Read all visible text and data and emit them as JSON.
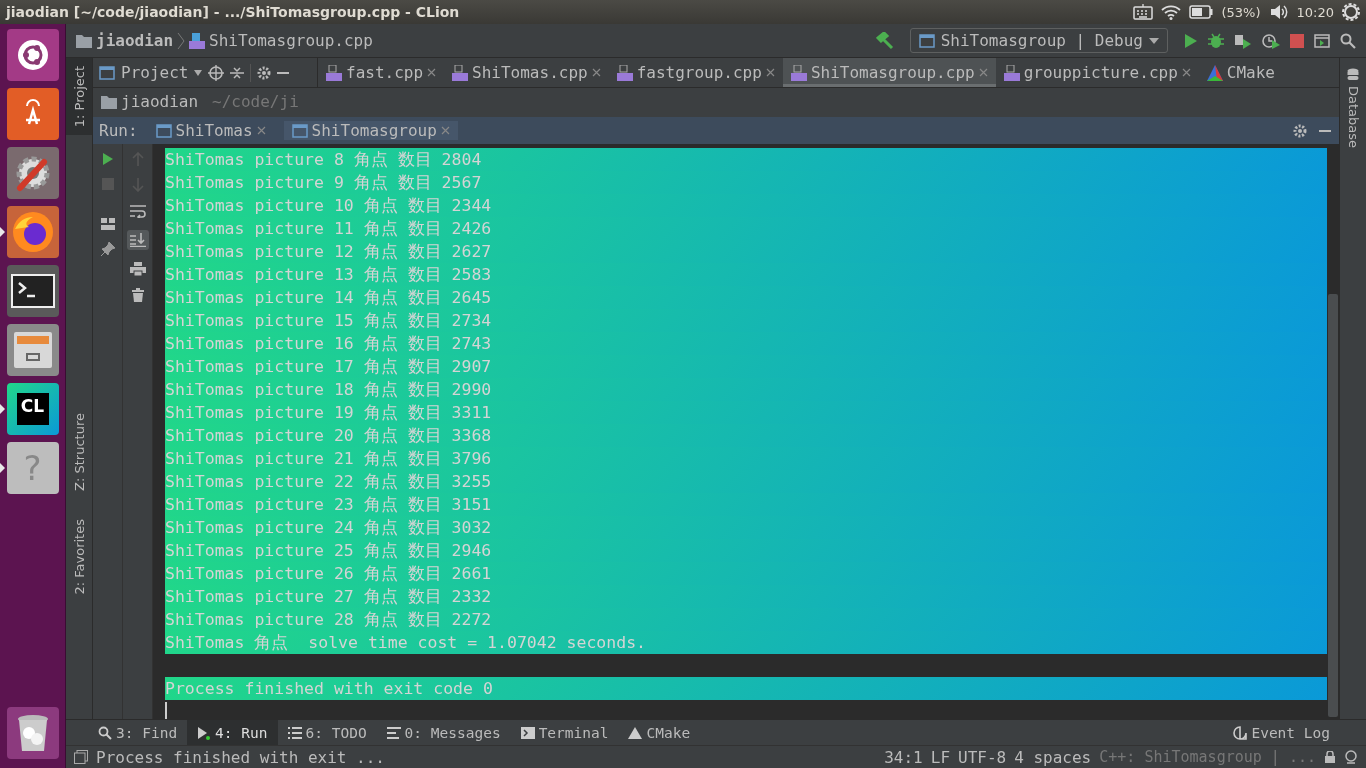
{
  "top_bar": {
    "title": "jiaodian [~/code/jiaodian] - .../ShiTomasgroup.cpp - CLion",
    "battery": "(53%)",
    "clock": "10:20"
  },
  "launcher": [
    {
      "kind": "ubuntu",
      "running": false
    },
    {
      "kind": "software",
      "running": false
    },
    {
      "kind": "settings",
      "running": false
    },
    {
      "kind": "browser",
      "running": true
    },
    {
      "kind": "terminal",
      "running": false
    },
    {
      "kind": "files",
      "running": false
    },
    {
      "kind": "clion",
      "running": true,
      "glyph": "CL"
    },
    {
      "kind": "help",
      "running": true,
      "glyph": "?"
    },
    {
      "kind": "trash",
      "running": false
    }
  ],
  "nav_bar": {
    "project": "jiaodian",
    "file": "ShiTomasgroup.cpp",
    "run_config": "ShiTomasgroup | Debug"
  },
  "project_panel": {
    "title": "Project",
    "root": "jiaodian",
    "path": "~/code/ji"
  },
  "editor_tabs": [
    {
      "label": "fast.cpp",
      "kind": "cpp",
      "selected": false
    },
    {
      "label": "ShiTomas.cpp",
      "kind": "cpp",
      "selected": false
    },
    {
      "label": "fastgroup.cpp",
      "kind": "cpp",
      "selected": false
    },
    {
      "label": "ShiTomasgroup.cpp",
      "kind": "cpp",
      "selected": true
    },
    {
      "label": "grouppicture.cpp",
      "kind": "cpp",
      "selected": false
    },
    {
      "label": "CMake",
      "kind": "cmake",
      "selected": false
    }
  ],
  "left_strip": [
    {
      "label": "1: Project",
      "selected": true
    },
    {
      "label": "Z: Structure",
      "selected": false
    },
    {
      "label": "2: Favorites",
      "selected": false
    }
  ],
  "right_strip": [
    {
      "label": "Database"
    }
  ],
  "run_panel": {
    "label": "Run:",
    "tabs": [
      {
        "label": "ShiTomas",
        "selected": false
      },
      {
        "label": "ShiTomasgroup",
        "selected": true
      }
    ]
  },
  "console": {
    "lines": [
      "ShiTomas picture 8 角点 数目 2804",
      "ShiTomas picture 9 角点 数目 2567",
      "ShiTomas picture 10 角点 数目 2344",
      "ShiTomas picture 11 角点 数目 2426",
      "ShiTomas picture 12 角点 数目 2627",
      "ShiTomas picture 13 角点 数目 2583",
      "ShiTomas picture 14 角点 数目 2645",
      "ShiTomas picture 15 角点 数目 2734",
      "ShiTomas picture 16 角点 数目 2743",
      "ShiTomas picture 17 角点 数目 2907",
      "ShiTomas picture 18 角点 数目 2990",
      "ShiTomas picture 19 角点 数目 3311",
      "ShiTomas picture 20 角点 数目 3368",
      "ShiTomas picture 21 角点 数目 3796",
      "ShiTomas picture 22 角点 数目 3255",
      "ShiTomas picture 23 角点 数目 3151",
      "ShiTomas picture 24 角点 数目 3032",
      "ShiTomas picture 25 角点 数目 2946",
      "ShiTomas picture 26 角点 数目 2661",
      "ShiTomas picture 27 角点 数目 2332",
      "ShiTomas picture 28 角点 数目 2272",
      "ShiTomas 角点  solve time cost = 1.07042 seconds."
    ],
    "exit_message": "Process finished with exit code 0"
  },
  "tool_buttons": [
    {
      "label": "3: Find",
      "kind": "find",
      "selected": false
    },
    {
      "label": "4: Run",
      "kind": "run",
      "selected": true
    },
    {
      "label": "6: TODO",
      "kind": "todo",
      "selected": false
    },
    {
      "label": "0: Messages",
      "kind": "messages",
      "selected": false
    },
    {
      "label": "Terminal",
      "kind": "terminal",
      "selected": false
    },
    {
      "label": "CMake",
      "kind": "cmake",
      "selected": false
    }
  ],
  "event_log": "Event Log",
  "status_bar": {
    "message": "Process finished with exit ...",
    "position": "34:1",
    "line_sep": "LF",
    "encoding": "UTF-8",
    "indent": "4 spaces",
    "context": "C++: ShiTomasgroup | ..."
  }
}
